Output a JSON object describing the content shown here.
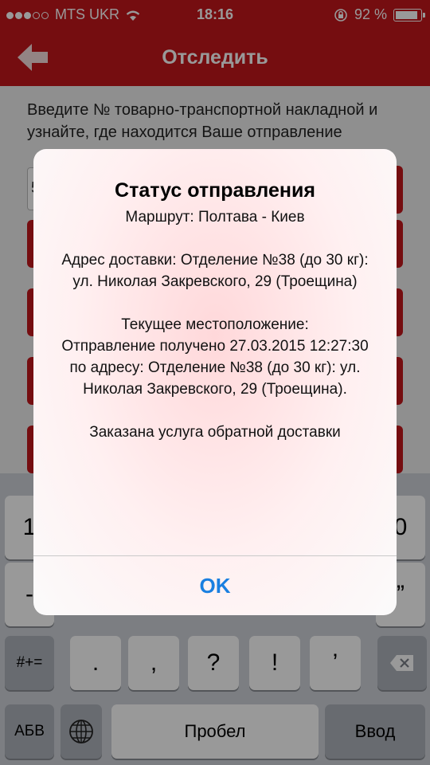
{
  "status_bar": {
    "carrier": "MTS UKR",
    "time": "18:16",
    "battery": "92 %"
  },
  "nav": {
    "title": "Отследить"
  },
  "content": {
    "intro": "Введите № товарно-транспортной накладной и узнайте, где находится Ваше отправление",
    "field_value": "5"
  },
  "alert": {
    "title": "Статус отправления",
    "route": "Маршрут: Полтава - Киев",
    "address": "Адрес доставки: Отделение №38 (до 30 кг): ул. Николая Закревского, 29 (Троещина)",
    "current_location_label": "Текущее местоположение:",
    "current_location": "Отправление получено 27.03.2015 12:27:30 по адресу: Отделение №38 (до 30 кг): ул. Николая Закревского, 29 (Троещина).",
    "extra": "Заказана услуга обратной доставки",
    "ok": "OK"
  },
  "keyboard": {
    "row1": [
      "1",
      "0"
    ],
    "row2": [
      "-",
      "”"
    ],
    "row3": [
      "#+=",
      ".",
      ",",
      "?",
      "!",
      "’"
    ],
    "row4": {
      "abc": "АБВ",
      "space": "Пробел",
      "enter": "Ввод"
    }
  }
}
